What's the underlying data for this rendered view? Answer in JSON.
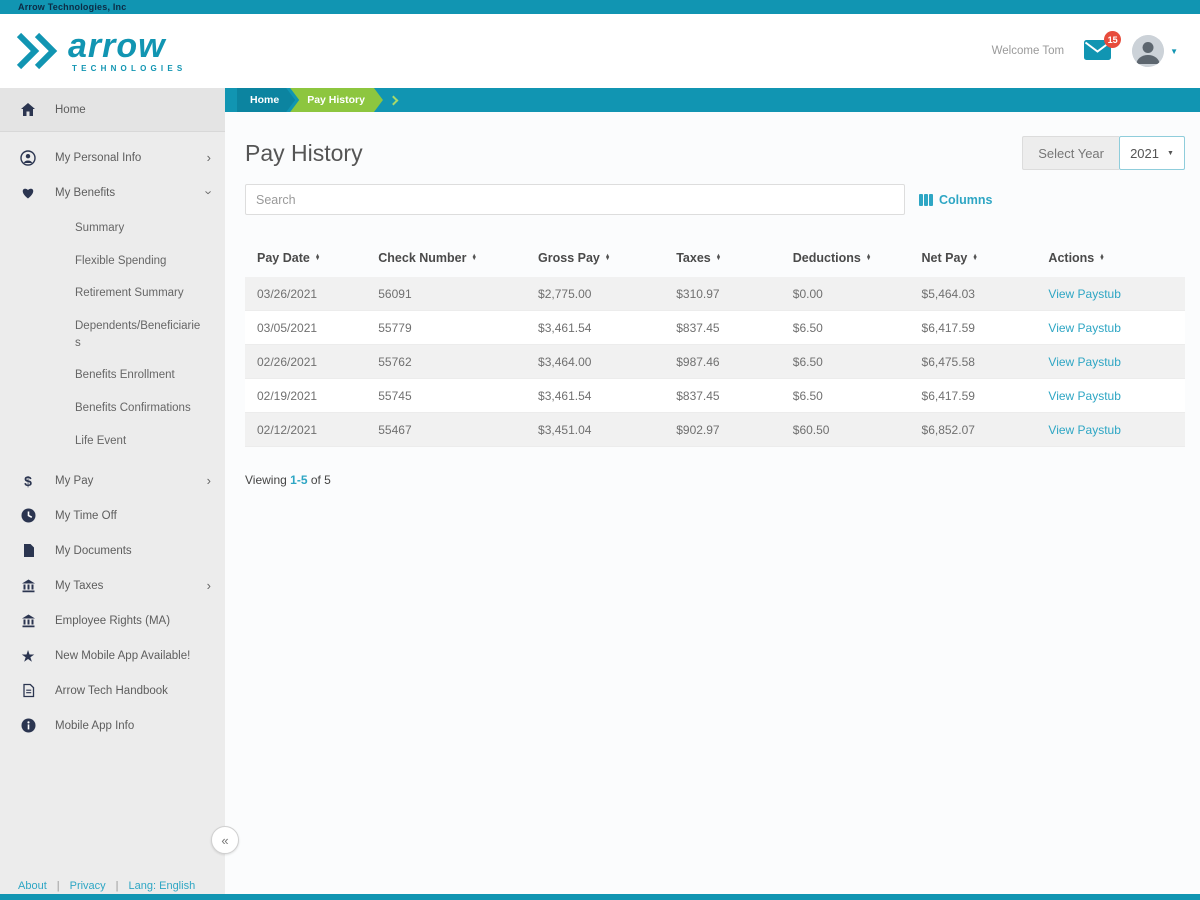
{
  "colors": {
    "teal": "#1195b2",
    "teal_dark": "#0c84a0",
    "link": "#2ea6c4",
    "green": "#8dc63f",
    "sidebar_bg": "#ececec",
    "sidebar_item_active_bg": "#e4e4e4",
    "main_bg": "#fbfcfd",
    "row_alt": "#f1f1f1",
    "badge_red": "#e74c3c",
    "icon_navy": "#2b3550"
  },
  "top_bar": {
    "company_name": "Arrow Technologies, Inc"
  },
  "header": {
    "logo_word": "arrow",
    "logo_subtitle": "TECHNOLOGIES",
    "welcome_text": "Welcome Tom",
    "mail_badge_count": "15"
  },
  "breadcrumb": {
    "home": "Home",
    "current": "Pay History"
  },
  "sidebar": {
    "items": [
      {
        "label": "Home"
      },
      {
        "label": "My Personal Info"
      },
      {
        "label": "My Benefits"
      },
      {
        "label": "My Pay"
      },
      {
        "label": "My Time Off"
      },
      {
        "label": "My Documents"
      },
      {
        "label": "My Taxes"
      },
      {
        "label": "Employee Rights (MA)"
      },
      {
        "label": "New Mobile App Available!"
      },
      {
        "label": "Arrow Tech Handbook"
      },
      {
        "label": "Mobile App Info"
      }
    ],
    "benefits_submenu": [
      {
        "label": "Summary"
      },
      {
        "label": "Flexible Spending"
      },
      {
        "label": "Retirement Summary"
      },
      {
        "label": "Dependents/Beneficiaries"
      },
      {
        "label": "Benefits Enrollment"
      },
      {
        "label": "Benefits Confirmations"
      },
      {
        "label": "Life Event"
      }
    ],
    "footer_links": [
      {
        "label": "About"
      },
      {
        "label": "Privacy"
      },
      {
        "label": "Lang: English"
      }
    ]
  },
  "main": {
    "page_title": "Pay History",
    "year_filter": {
      "label": "Select Year",
      "selected": "2021"
    },
    "search_placeholder": "Search",
    "columns_button_label": "Columns",
    "table": {
      "headers": [
        {
          "label": "Pay Date"
        },
        {
          "label": "Check Number"
        },
        {
          "label": "Gross Pay"
        },
        {
          "label": "Taxes"
        },
        {
          "label": "Deductions"
        },
        {
          "label": "Net Pay"
        },
        {
          "label": "Actions"
        }
      ],
      "rows": [
        {
          "pay_date": "03/26/2021",
          "check_number": "56091",
          "gross_pay": "$2,775.00",
          "taxes": "$310.97",
          "deductions": "$0.00",
          "net_pay": "$5,464.03",
          "action": "View Paystub"
        },
        {
          "pay_date": "03/05/2021",
          "check_number": "55779",
          "gross_pay": "$3,461.54",
          "taxes": "$837.45",
          "deductions": "$6.50",
          "net_pay": "$6,417.59",
          "action": "View Paystub"
        },
        {
          "pay_date": "02/26/2021",
          "check_number": "55762",
          "gross_pay": "$3,464.00",
          "taxes": "$987.46",
          "deductions": "$6.50",
          "net_pay": "$6,475.58",
          "action": "View Paystub"
        },
        {
          "pay_date": "02/19/2021",
          "check_number": "55745",
          "gross_pay": "$3,461.54",
          "taxes": "$837.45",
          "deductions": "$6.50",
          "net_pay": "$6,417.59",
          "action": "View Paystub"
        },
        {
          "pay_date": "02/12/2021",
          "check_number": "55467",
          "gross_pay": "$3,451.04",
          "taxes": "$902.97",
          "deductions": "$60.50",
          "net_pay": "$6,852.07",
          "action": "View Paystub"
        }
      ]
    },
    "pagination": {
      "prefix": "Viewing",
      "range": "1-5",
      "suffix": "of 5"
    }
  },
  "glyphs": {
    "chevron": "›",
    "sort_up": "▲",
    "sort_down": "▼",
    "caret_down": "▼",
    "collapse": "«",
    "star": "★",
    "dollar": "$",
    "separator": "|"
  }
}
